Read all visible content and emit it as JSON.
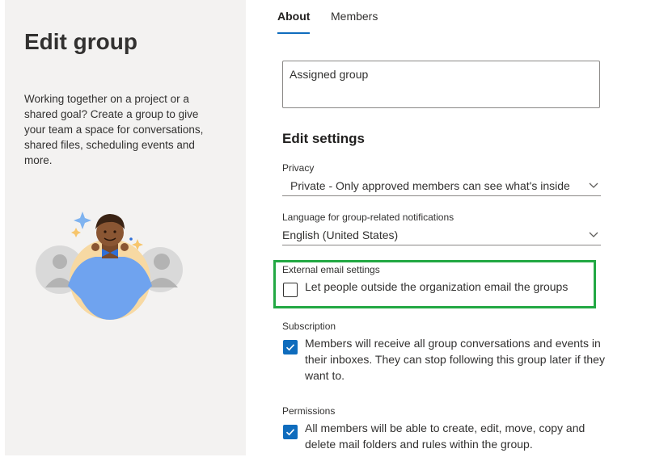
{
  "left_panel": {
    "title": "Edit group",
    "description": "Working together on a project or a shared goal? Create a group to give your team a space for conversations, shared files, scheduling events and more."
  },
  "tabs": [
    {
      "label": "About",
      "selected": true
    },
    {
      "label": "Members",
      "selected": false
    }
  ],
  "description_field": {
    "value": "Assigned group"
  },
  "edit_settings": {
    "title": "Edit settings"
  },
  "privacy": {
    "label": "Privacy",
    "value": "Private - Only approved members can see what's inside"
  },
  "language": {
    "label": "Language for group-related notifications",
    "value": "English (United States)"
  },
  "external_email": {
    "label": "External email settings",
    "checkbox_label": "Let people outside the organization email the groups",
    "checked": false
  },
  "subscription": {
    "label": "Subscription",
    "checkbox_label": "Members will receive all group conversations and events in their inboxes. They can stop following this group later if they want to.",
    "checked": true
  },
  "permissions": {
    "label": "Permissions",
    "checkbox_label": "All members will be able to create, edit, move, copy and delete mail folders and rules within the group.",
    "checked": true
  },
  "colors": {
    "accent": "#0f6cbd",
    "highlight_border": "#22a843",
    "panel_bg": "#f3f2f1"
  },
  "icons": [
    "chevron-down-icon",
    "checkmark-icon",
    "people-illustration"
  ]
}
